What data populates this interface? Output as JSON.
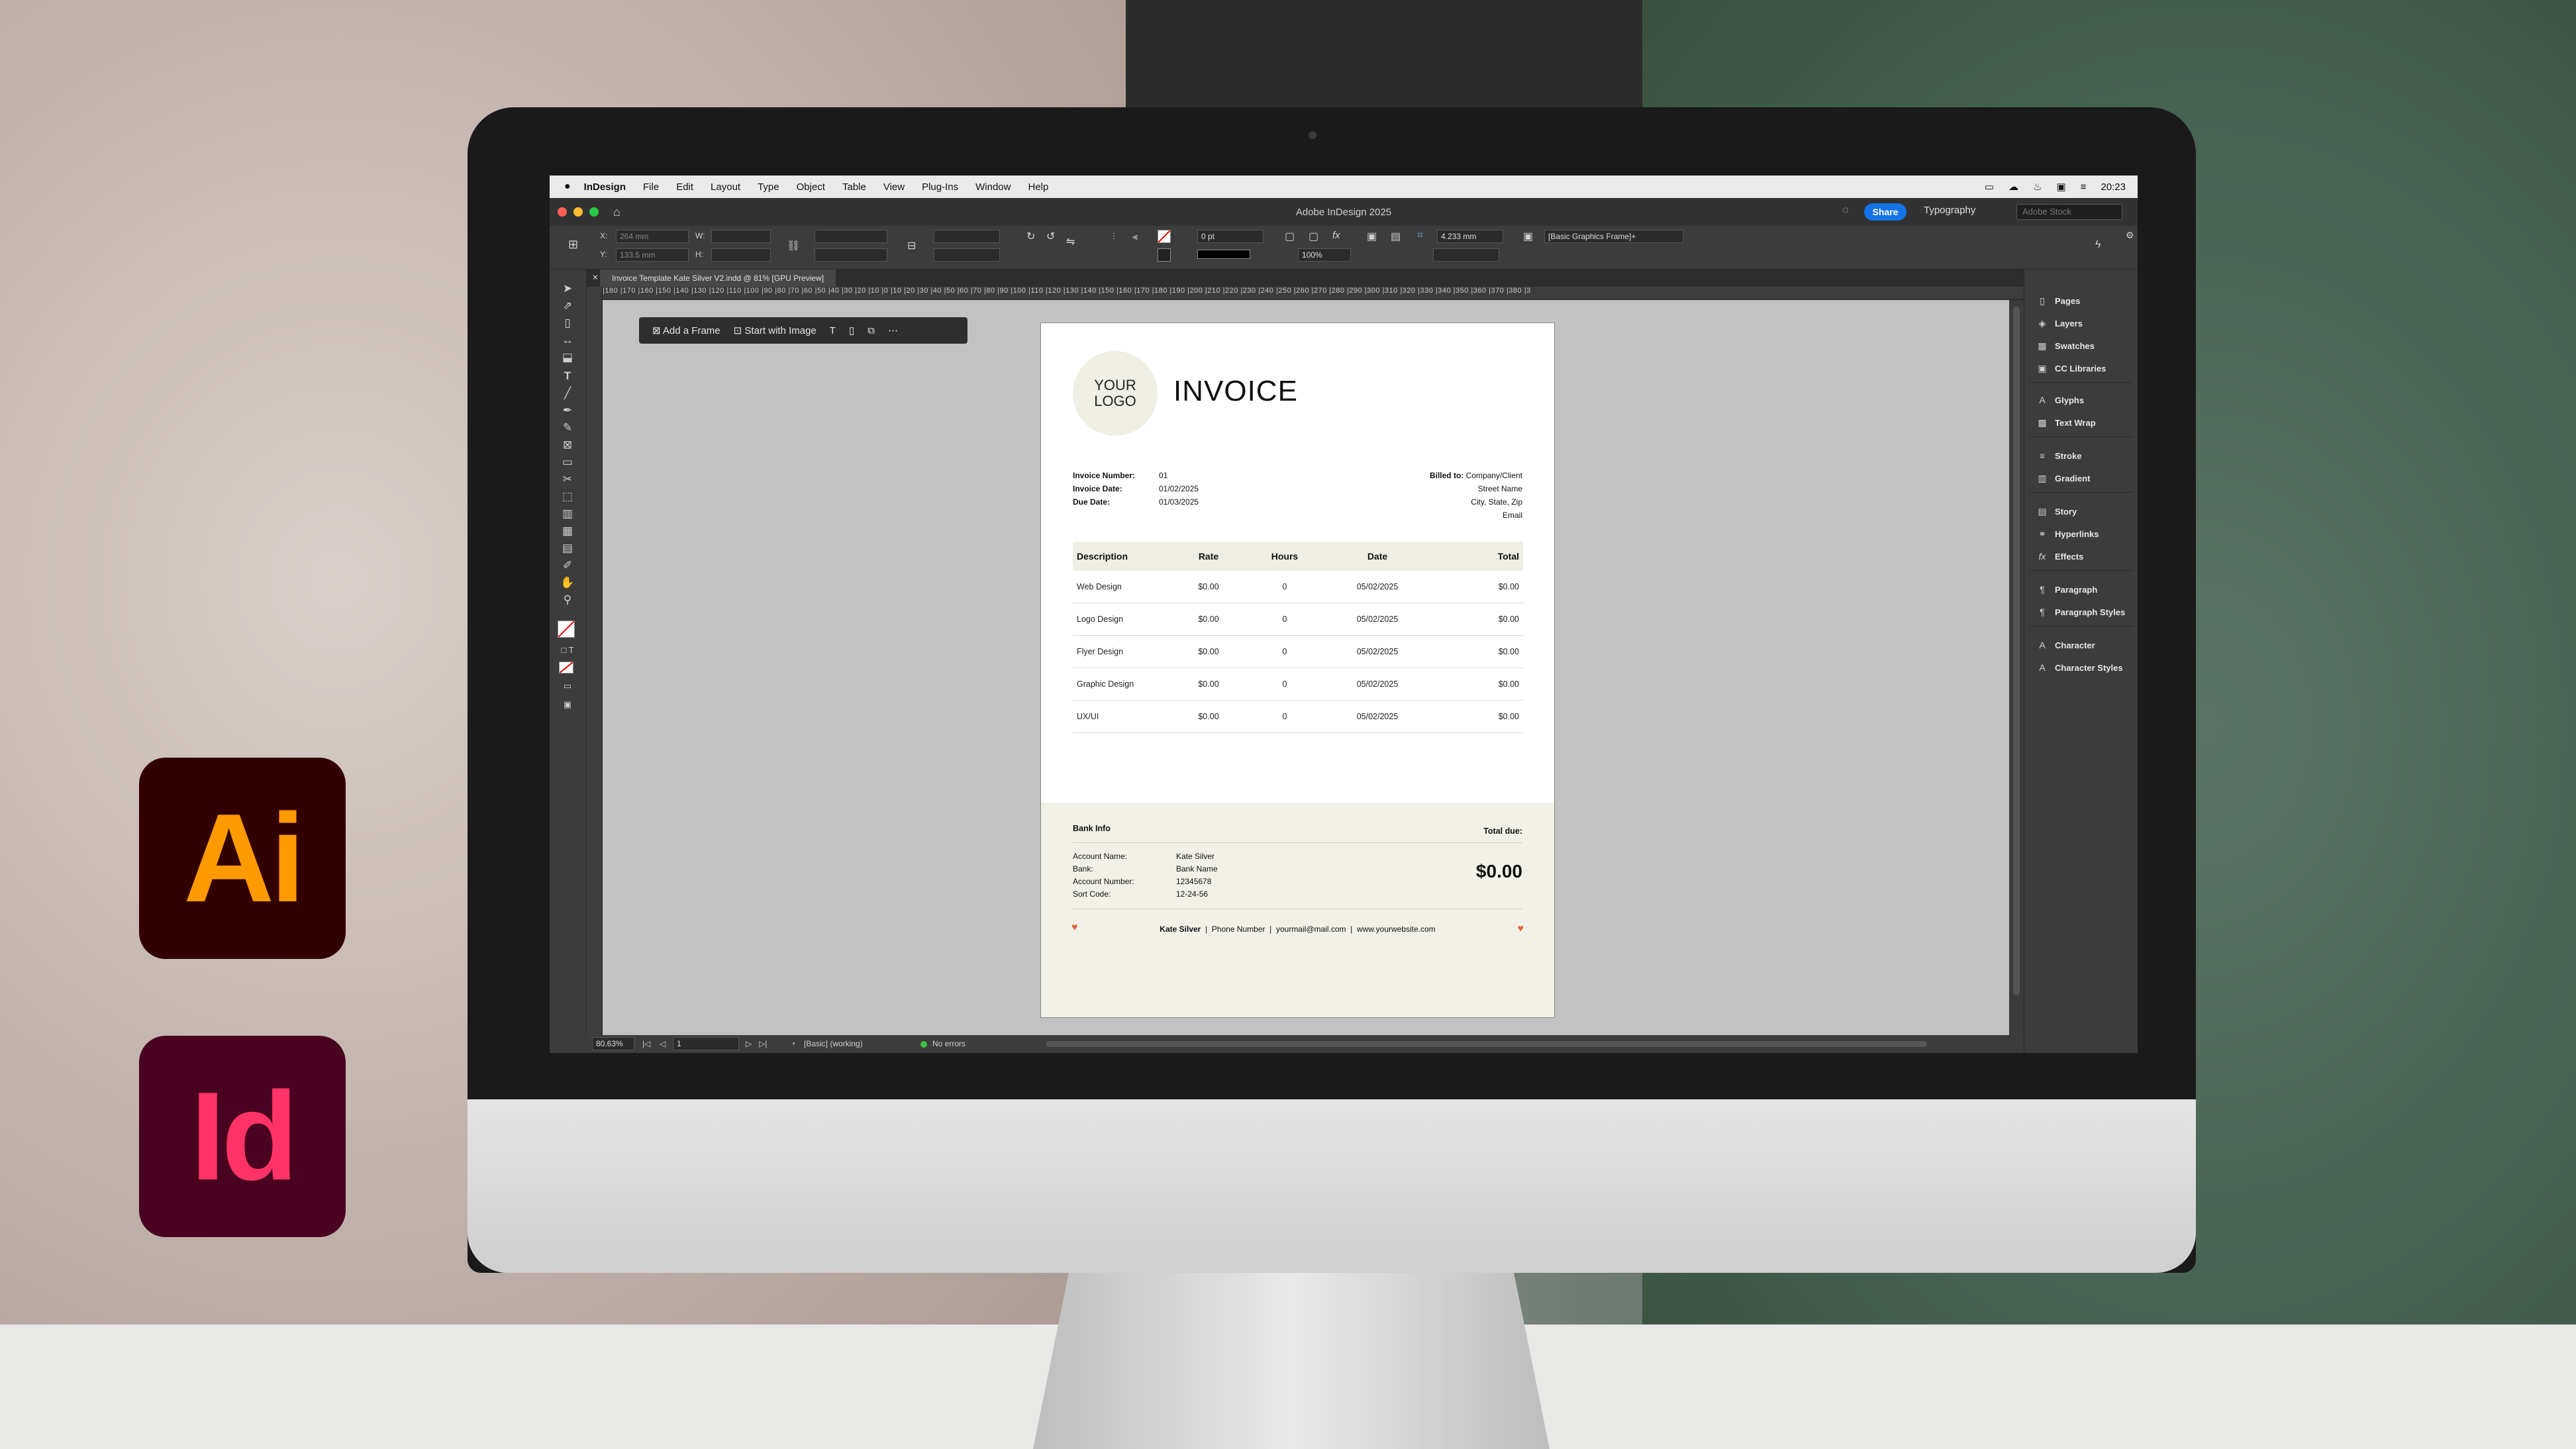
{
  "menubar": {
    "app": "InDesign",
    "items": [
      "File",
      "Edit",
      "Layout",
      "Type",
      "Object",
      "Table",
      "View",
      "Plug-Ins",
      "Window",
      "Help"
    ],
    "clock": "20:23"
  },
  "titlebar": {
    "title": "Adobe InDesign 2025",
    "share": "Share",
    "workspace": "Typography",
    "stock_placeholder": "Adobe Stock"
  },
  "control": {
    "x": "264 mm",
    "y": "133.5 mm",
    "stroke_weight": "0 pt",
    "scale": "100%",
    "frame_size": "4.233 mm",
    "object_style": "[Basic Graphics Frame]+"
  },
  "tab": {
    "label": "Invoice Template Kate Silver V2.indd @ 81% [GPU Preview]"
  },
  "ruler": "|180 |170 |160 |150 |140 |130 |120 |110 |100 |90 |80 |70 |60 |50 |40 |30 |20 |10 |0 |10 |20 |30 |40 |50 |60 |70 |80 |90 |100 |110 |120 |130 |140 |150 |160 |170 |180 |190 |200 |210 |220 |230 |240 |250 |260 |270 |280 |290 |300 |310 |320 |330 |340 |350 |360 |370 |380 |3",
  "contextbar": {
    "add_frame": "Add a Frame",
    "start_image": "Start with Image"
  },
  "status": {
    "zoom": "80.63%",
    "page": "1",
    "profile": "[Basic] (working)",
    "errors": "No errors"
  },
  "panels": [
    "Pages",
    "Layers",
    "Swatches",
    "CC Libraries",
    "Glyphs",
    "Text Wrap",
    "Stroke",
    "Gradient",
    "Story",
    "Hyperlinks",
    "Effects",
    "Paragraph",
    "Paragraph Styles",
    "Character",
    "Character Styles"
  ],
  "invoice": {
    "logo_line1": "YOUR",
    "logo_line2": "LOGO",
    "title": "INVOICE",
    "labels": {
      "number": "Invoice Number:",
      "date": "Invoice Date:",
      "due": "Due Date:"
    },
    "values": {
      "number": "01",
      "date": "01/02/2025",
      "due": "01/03/2025"
    },
    "billed_label": "Billed to:",
    "billed": [
      "Company/Client",
      "Street Name",
      "City, State, Zip",
      "Email"
    ],
    "headers": [
      "Description",
      "Rate",
      "Hours",
      "Date",
      "Total"
    ],
    "rows": [
      [
        "Web Design",
        "$0.00",
        "0",
        "05/02/2025",
        "$0.00"
      ],
      [
        "Logo Design",
        "$0.00",
        "0",
        "05/02/2025",
        "$0.00"
      ],
      [
        "Flyer Design",
        "$0.00",
        "0",
        "05/02/2025",
        "$0.00"
      ],
      [
        "Graphic Design",
        "$0.00",
        "0",
        "05/02/2025",
        "$0.00"
      ],
      [
        "UX/UI",
        "$0.00",
        "0",
        "05/02/2025",
        "$0.00"
      ]
    ],
    "bank_title": "Bank Info",
    "total_label": "Total due:",
    "total": "$0.00",
    "bank_labels": [
      "Account Name:",
      "Bank:",
      "Account Number:",
      "Sort Code:"
    ],
    "bank_values": [
      "Kate Silver",
      "Bank Name",
      "12345678",
      "12-24-56"
    ],
    "footer": {
      "name": "Kate Silver",
      "phone": "Phone Number",
      "email": "yourmail@mail.com",
      "web": "www.yourwebsite.com"
    }
  },
  "logos": {
    "illustrator": "Ai",
    "indesign": "Id"
  },
  "colors": {
    "accent": "#1473e6",
    "heart": "#e8613c",
    "ai_bg": "#330000",
    "ai_fg": "#ff9a00",
    "id_bg": "#49021f",
    "id_fg": "#ff3366"
  }
}
